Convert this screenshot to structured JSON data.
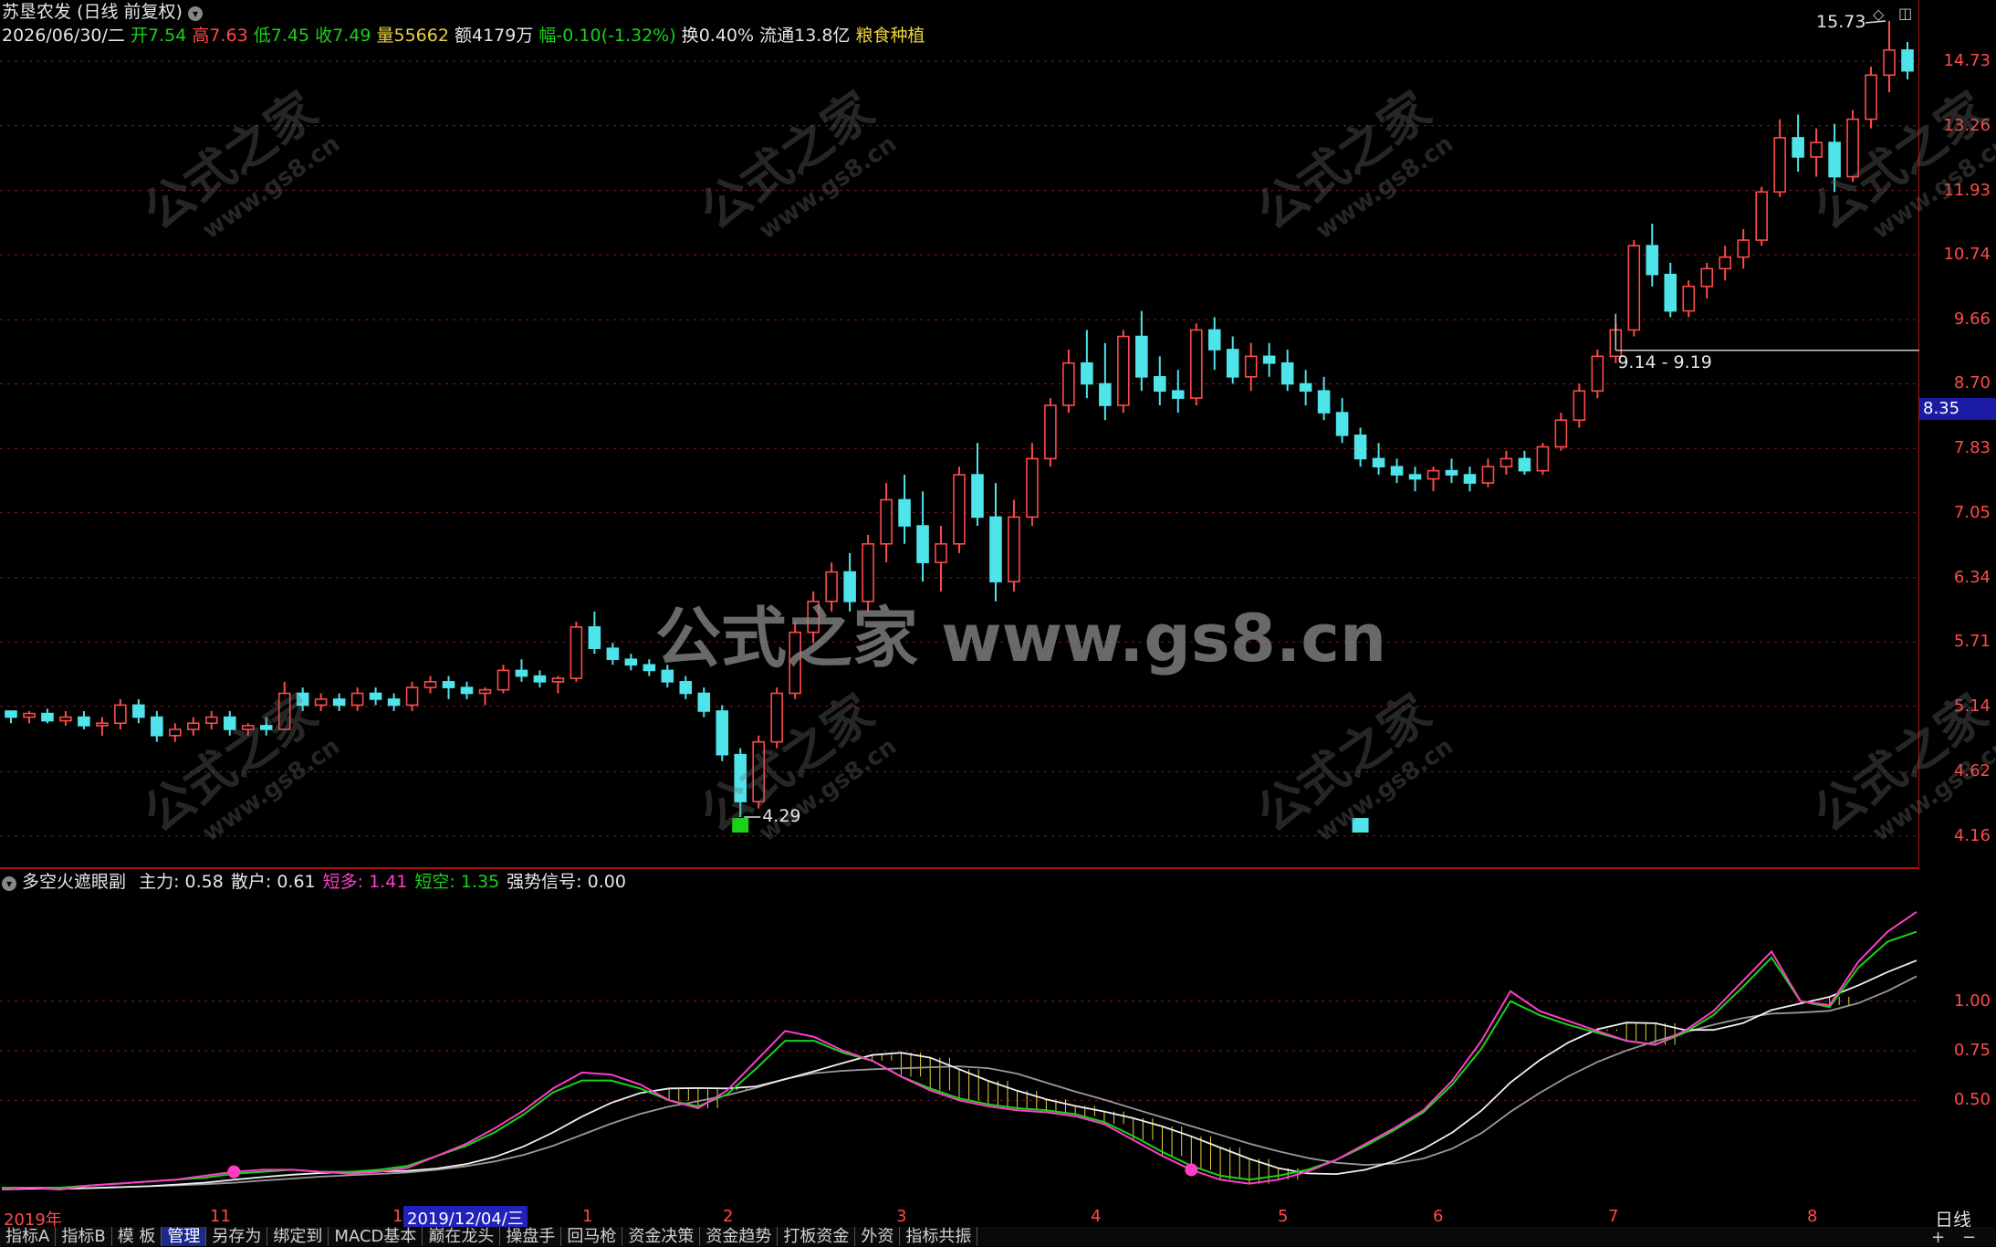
{
  "header": {
    "stock_name": "苏垦农发",
    "period_label": "(日线 前复权)",
    "date": "2026/06/30/二",
    "open_label": "开",
    "open": "7.54",
    "high_label": "高",
    "high": "7.63",
    "low_label": "低",
    "low": "7.45",
    "close_label": "收",
    "close": "7.49",
    "volume_label": "量",
    "volume": "55662",
    "amount_label": "额",
    "amount": "4179万",
    "change_label": "幅",
    "change": "-0.10(-1.32%)",
    "turnover_label": "换",
    "turnover": "0.40%",
    "float_label": "流通",
    "float_cap": "13.8亿",
    "sector": "粮食种植"
  },
  "right_axis": {
    "price_labels": [
      "14.73",
      "13.26",
      "11.93",
      "10.74",
      "9.66",
      "8.70",
      "7.83",
      "7.05",
      "6.34",
      "5.71",
      "5.14",
      "4.62",
      "4.16"
    ],
    "current_price": "8.35",
    "sub_labels": [
      "1.00",
      "0.75",
      "0.50"
    ],
    "period": "日线"
  },
  "annotations": {
    "max_label": "15.73",
    "min_label": "4.29",
    "range_label": "9.14 - 9.19"
  },
  "sub_indicator": {
    "name": "多空火遮眼副",
    "items": [
      {
        "label": "主力:",
        "value": "0.58",
        "color": "#e6e6e6"
      },
      {
        "label": "散户:",
        "value": "0.61",
        "color": "#e6e6e6"
      },
      {
        "label": "短多:",
        "value": "1.41",
        "color": "#ff3ec8"
      },
      {
        "label": "短空:",
        "value": "1.35",
        "color": "#19d219"
      },
      {
        "label": "强势信号:",
        "value": "0.00",
        "color": "#e6e6e6"
      }
    ]
  },
  "x_axis": {
    "labels": [
      "2019年",
      "11",
      "12",
      "1",
      "2",
      "3",
      "4",
      "5",
      "6",
      "7",
      "8"
    ],
    "cursor_date": "2019/12/04/三"
  },
  "tabs": [
    "指标A",
    "指标B",
    "模 板",
    "管理",
    "另存为",
    "绑定到",
    "MACD基本",
    "巅在龙头",
    "操盘手",
    "回马枪",
    "资金决策",
    "资金趋势",
    "打板资金",
    "外资",
    "指标共振"
  ],
  "watermark": {
    "big": "公式之家 www.gs8.cn",
    "small_cn": "公式之家",
    "small_url": "www.gs8.cn"
  },
  "colors": {
    "up": "#ff4a4a",
    "down": "#4fe3ea",
    "grid": "#8a1a1a",
    "frame": "#b01010"
  },
  "chart_data": [
    {
      "type": "candlestick",
      "title": "苏垦农发 (日线 前复权)",
      "x_range": [
        "2019-10",
        "2020-08"
      ],
      "ylim": [
        4.0,
        15.8
      ],
      "y_scale": "log",
      "grid": true,
      "points": [
        [
          5.1,
          5.1,
          5.0,
          5.05
        ],
        [
          5.05,
          5.1,
          5.0,
          5.08
        ],
        [
          5.08,
          5.12,
          5.0,
          5.02
        ],
        [
          5.02,
          5.1,
          4.98,
          5.05
        ],
        [
          5.05,
          5.1,
          4.95,
          4.98
        ],
        [
          4.98,
          5.05,
          4.9,
          5.0
        ],
        [
          5.0,
          5.2,
          4.95,
          5.15
        ],
        [
          5.15,
          5.2,
          5.0,
          5.05
        ],
        [
          5.05,
          5.1,
          4.85,
          4.9
        ],
        [
          4.9,
          5.0,
          4.85,
          4.95
        ],
        [
          4.95,
          5.05,
          4.9,
          5.0
        ],
        [
          5.0,
          5.1,
          4.95,
          5.05
        ],
        [
          5.05,
          5.1,
          4.9,
          4.95
        ],
        [
          4.95,
          5.0,
          4.9,
          4.98
        ],
        [
          4.98,
          5.05,
          4.9,
          4.95
        ],
        [
          4.95,
          5.35,
          4.95,
          5.25
        ],
        [
          5.25,
          5.3,
          5.1,
          5.15
        ],
        [
          5.15,
          5.25,
          5.1,
          5.2
        ],
        [
          5.2,
          5.25,
          5.1,
          5.15
        ],
        [
          5.15,
          5.3,
          5.1,
          5.25
        ],
        [
          5.25,
          5.3,
          5.15,
          5.2
        ],
        [
          5.2,
          5.25,
          5.1,
          5.15
        ],
        [
          5.15,
          5.35,
          5.1,
          5.3
        ],
        [
          5.3,
          5.4,
          5.25,
          5.35
        ],
        [
          5.35,
          5.4,
          5.2,
          5.3
        ],
        [
          5.3,
          5.35,
          5.2,
          5.25
        ],
        [
          5.25,
          5.3,
          5.15,
          5.28
        ],
        [
          5.28,
          5.5,
          5.25,
          5.45
        ],
        [
          5.45,
          5.55,
          5.35,
          5.4
        ],
        [
          5.4,
          5.45,
          5.3,
          5.35
        ],
        [
          5.35,
          5.4,
          5.25,
          5.38
        ],
        [
          5.38,
          5.9,
          5.35,
          5.85
        ],
        [
          5.85,
          6.0,
          5.6,
          5.65
        ],
        [
          5.65,
          5.7,
          5.5,
          5.55
        ],
        [
          5.55,
          5.6,
          5.45,
          5.5
        ],
        [
          5.5,
          5.55,
          5.4,
          5.45
        ],
        [
          5.45,
          5.5,
          5.3,
          5.35
        ],
        [
          5.35,
          5.4,
          5.2,
          5.25
        ],
        [
          5.25,
          5.3,
          5.05,
          5.1
        ],
        [
          5.1,
          5.15,
          4.7,
          4.75
        ],
        [
          4.75,
          4.8,
          4.29,
          4.4
        ],
        [
          4.4,
          4.9,
          4.35,
          4.85
        ],
        [
          4.85,
          5.3,
          4.8,
          5.25
        ],
        [
          5.25,
          5.9,
          5.2,
          5.8
        ],
        [
          5.8,
          6.2,
          5.7,
          6.1
        ],
        [
          6.1,
          6.5,
          6.0,
          6.4
        ],
        [
          6.4,
          6.6,
          6.0,
          6.1
        ],
        [
          6.1,
          6.8,
          6.0,
          6.7
        ],
        [
          6.7,
          7.4,
          6.5,
          7.2
        ],
        [
          7.2,
          7.5,
          6.7,
          6.9
        ],
        [
          6.9,
          7.3,
          6.3,
          6.5
        ],
        [
          6.5,
          6.9,
          6.2,
          6.7
        ],
        [
          6.7,
          7.6,
          6.6,
          7.5
        ],
        [
          7.5,
          7.9,
          6.9,
          7.0
        ],
        [
          7.0,
          7.4,
          6.1,
          6.3
        ],
        [
          6.3,
          7.2,
          6.2,
          7.0
        ],
        [
          7.0,
          7.9,
          6.9,
          7.7
        ],
        [
          7.7,
          8.5,
          7.6,
          8.4
        ],
        [
          8.4,
          9.2,
          8.3,
          9.0
        ],
        [
          9.0,
          9.5,
          8.5,
          8.7
        ],
        [
          8.7,
          9.3,
          8.2,
          8.4
        ],
        [
          8.4,
          9.5,
          8.3,
          9.4
        ],
        [
          9.4,
          9.8,
          8.6,
          8.8
        ],
        [
          8.8,
          9.1,
          8.4,
          8.6
        ],
        [
          8.6,
          8.9,
          8.3,
          8.5
        ],
        [
          8.5,
          9.6,
          8.4,
          9.5
        ],
        [
          9.5,
          9.7,
          8.9,
          9.2
        ],
        [
          9.2,
          9.4,
          8.7,
          8.8
        ],
        [
          8.8,
          9.3,
          8.6,
          9.1
        ],
        [
          9.1,
          9.3,
          8.8,
          9.0
        ],
        [
          9.0,
          9.2,
          8.6,
          8.7
        ],
        [
          8.7,
          8.9,
          8.4,
          8.6
        ],
        [
          8.6,
          8.8,
          8.2,
          8.3
        ],
        [
          8.3,
          8.5,
          7.9,
          8.0
        ],
        [
          8.0,
          8.1,
          7.6,
          7.7
        ],
        [
          7.7,
          7.9,
          7.5,
          7.6
        ],
        [
          7.6,
          7.7,
          7.4,
          7.5
        ],
        [
          7.5,
          7.6,
          7.3,
          7.45
        ],
        [
          7.45,
          7.6,
          7.3,
          7.55
        ],
        [
          7.55,
          7.7,
          7.4,
          7.5
        ],
        [
          7.5,
          7.6,
          7.3,
          7.4
        ],
        [
          7.4,
          7.7,
          7.35,
          7.6
        ],
        [
          7.6,
          7.8,
          7.5,
          7.7
        ],
        [
          7.7,
          7.8,
          7.5,
          7.55
        ],
        [
          7.55,
          7.9,
          7.5,
          7.85
        ],
        [
          7.85,
          8.3,
          7.8,
          8.2
        ],
        [
          8.2,
          8.7,
          8.1,
          8.6
        ],
        [
          8.6,
          9.2,
          8.5,
          9.1
        ],
        [
          9.1,
          9.6,
          9.0,
          9.5
        ],
        [
          9.5,
          11.0,
          9.4,
          10.9
        ],
        [
          10.9,
          11.3,
          10.2,
          10.4
        ],
        [
          10.4,
          10.6,
          9.7,
          9.8
        ],
        [
          9.8,
          10.3,
          9.7,
          10.2
        ],
        [
          10.2,
          10.6,
          10.0,
          10.5
        ],
        [
          10.5,
          10.9,
          10.3,
          10.7
        ],
        [
          10.7,
          11.2,
          10.5,
          11.0
        ],
        [
          11.0,
          12.0,
          10.9,
          11.9
        ],
        [
          11.9,
          13.4,
          11.8,
          13.0
        ],
        [
          13.0,
          13.5,
          12.3,
          12.6
        ],
        [
          12.6,
          13.2,
          12.2,
          12.9
        ],
        [
          12.9,
          13.3,
          11.9,
          12.2
        ],
        [
          12.2,
          13.6,
          12.1,
          13.4
        ],
        [
          13.4,
          14.6,
          13.2,
          14.4
        ],
        [
          14.4,
          15.73,
          14.0,
          15.0
        ],
        [
          15.0,
          15.2,
          14.3,
          14.5
        ]
      ]
    },
    {
      "type": "line",
      "title": "多空火遮眼副",
      "ylim": [
        0.0,
        1.5
      ],
      "series": [
        {
          "name": "短多",
          "values": [
            0.05,
            0.06,
            0.05,
            0.07,
            0.08,
            0.09,
            0.1,
            0.12,
            0.14,
            0.15,
            0.15,
            0.14,
            0.13,
            0.14,
            0.16,
            0.22,
            0.28,
            0.36,
            0.45,
            0.56,
            0.64,
            0.63,
            0.58,
            0.5,
            0.46,
            0.55,
            0.7,
            0.85,
            0.82,
            0.75,
            0.7,
            0.62,
            0.55,
            0.5,
            0.47,
            0.45,
            0.44,
            0.42,
            0.38,
            0.3,
            0.22,
            0.15,
            0.1,
            0.08,
            0.1,
            0.14,
            0.2,
            0.28,
            0.36,
            0.45,
            0.6,
            0.8,
            1.05,
            0.95,
            0.9,
            0.85,
            0.8,
            0.78,
            0.85,
            0.95,
            1.1,
            1.25,
            1.0,
            0.98,
            1.2,
            1.35,
            1.45
          ]
        },
        {
          "name": "短空",
          "values": [
            0.06,
            0.06,
            0.06,
            0.07,
            0.08,
            0.09,
            0.1,
            0.11,
            0.13,
            0.14,
            0.15,
            0.14,
            0.14,
            0.15,
            0.17,
            0.22,
            0.27,
            0.34,
            0.43,
            0.54,
            0.6,
            0.6,
            0.56,
            0.5,
            0.47,
            0.53,
            0.66,
            0.8,
            0.8,
            0.74,
            0.7,
            0.62,
            0.56,
            0.51,
            0.48,
            0.46,
            0.45,
            0.43,
            0.39,
            0.32,
            0.24,
            0.17,
            0.12,
            0.1,
            0.12,
            0.15,
            0.2,
            0.27,
            0.35,
            0.44,
            0.58,
            0.76,
            1.0,
            0.93,
            0.88,
            0.84,
            0.8,
            0.78,
            0.84,
            0.93,
            1.07,
            1.22,
            1.0,
            0.97,
            1.17,
            1.3,
            1.35
          ]
        }
      ]
    }
  ]
}
